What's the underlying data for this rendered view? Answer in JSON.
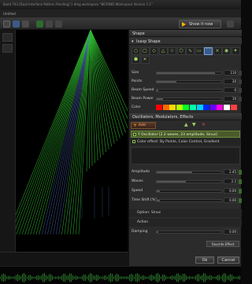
{
  "window": {
    "title": "Build 743   [Dual Interface Pattern Pending]   1 dmg workspace   \"BEYOND Workspace Version 1.1\""
  },
  "menubar": {
    "label": "Untitled"
  },
  "toolbar": {
    "show_label": "Show it now"
  },
  "panel": {
    "shape_tab": "Shape",
    "shape_section": "Ixasp Shape",
    "shape_icons": [
      "○",
      "▢",
      "◇",
      "△",
      "☆",
      "⬡",
      "∿",
      "▭",
      "⌒",
      "⨯",
      "◉",
      "✦",
      "⬢",
      "✕"
    ],
    "params": [
      {
        "label": "Size",
        "value": "110"
      },
      {
        "label": "Points",
        "value": "30"
      },
      {
        "label": "Beam Speed",
        "value": "0"
      },
      {
        "label": "Beam Power",
        "value": "10"
      }
    ],
    "color_label": "Color",
    "palette": [
      "#ff0000",
      "#ff6a00",
      "#ffd800",
      "#b6ff00",
      "#00ff21",
      "#00ffaa",
      "#00d0ff",
      "#0026ff",
      "#6a00ff",
      "#ff00dc",
      "#ffffff",
      "#ff3f3f"
    ],
    "osc_section": "Oscillators, Modulators, Effects",
    "add_label": "Add",
    "osc_items": [
      "Y Oscillator [2.2 waves, 23 amplitude, Sinus]",
      "Color effect: By Points, Color Control, Gradient"
    ],
    "osc_params": [
      {
        "label": "Amplitude",
        "value": "2.45"
      },
      {
        "label": "Waves",
        "value": "2.2"
      },
      {
        "label": "Speed",
        "value": "0.00"
      },
      {
        "label": "Time Shift [%]",
        "value": "0.00"
      }
    ],
    "option_label": "Option: Sinus",
    "action_label": "Action",
    "damping_label": "Damping",
    "damping_value": "0.00",
    "favorite_label": "Favorite Effect",
    "ok_label": "Ok",
    "cancel_label": "Cancel"
  },
  "colors": {
    "accent": "#ffb400",
    "beam": "#2fb82f",
    "panel": "#2b2b2b"
  }
}
